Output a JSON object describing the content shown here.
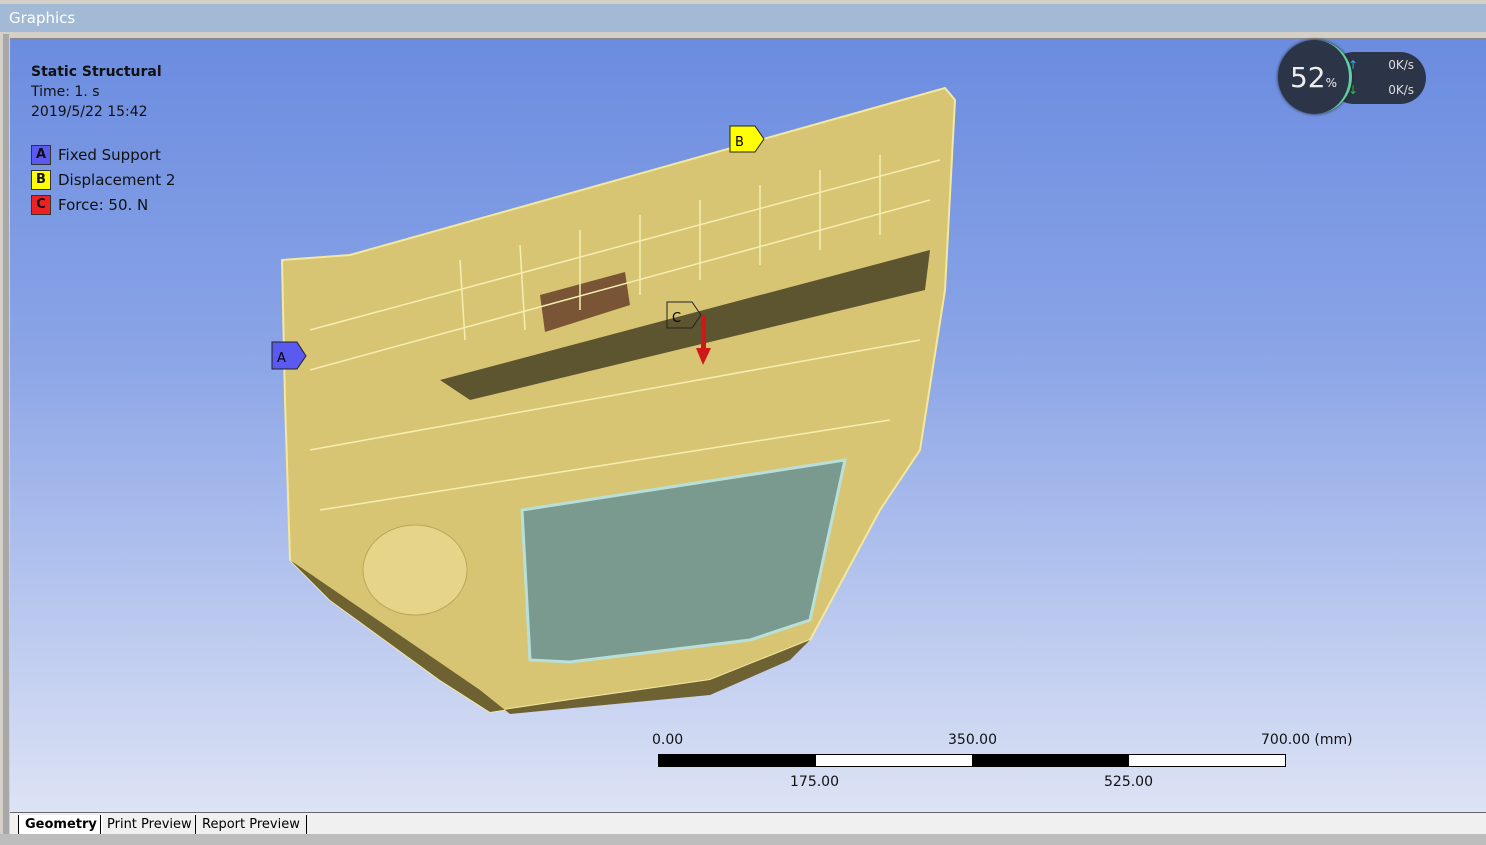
{
  "window": {
    "title": "Graphics"
  },
  "info": {
    "analysis": "Static Structural",
    "time": "Time: 1. s",
    "timestamp": "2019/5/22 15:42"
  },
  "legend": [
    {
      "letter": "A",
      "label": "Fixed Support",
      "color": "#5a5af0"
    },
    {
      "letter": "B",
      "label": "Displacement 2",
      "color": "#ffff00"
    },
    {
      "letter": "C",
      "label": "Force: 50. N",
      "color": "#ee2222"
    }
  ],
  "markers": {
    "a": "A",
    "b": "B",
    "c": "C"
  },
  "network": {
    "percent": "52",
    "percent_sign": "%",
    "upload": "0K/s",
    "download": "0K/s"
  },
  "scale": {
    "top": [
      "0.00",
      "350.00",
      "700.00 (mm)"
    ],
    "bottom": [
      "175.00",
      "525.00"
    ]
  },
  "tabs": [
    "Geometry",
    "Print Preview",
    "Report Preview"
  ]
}
